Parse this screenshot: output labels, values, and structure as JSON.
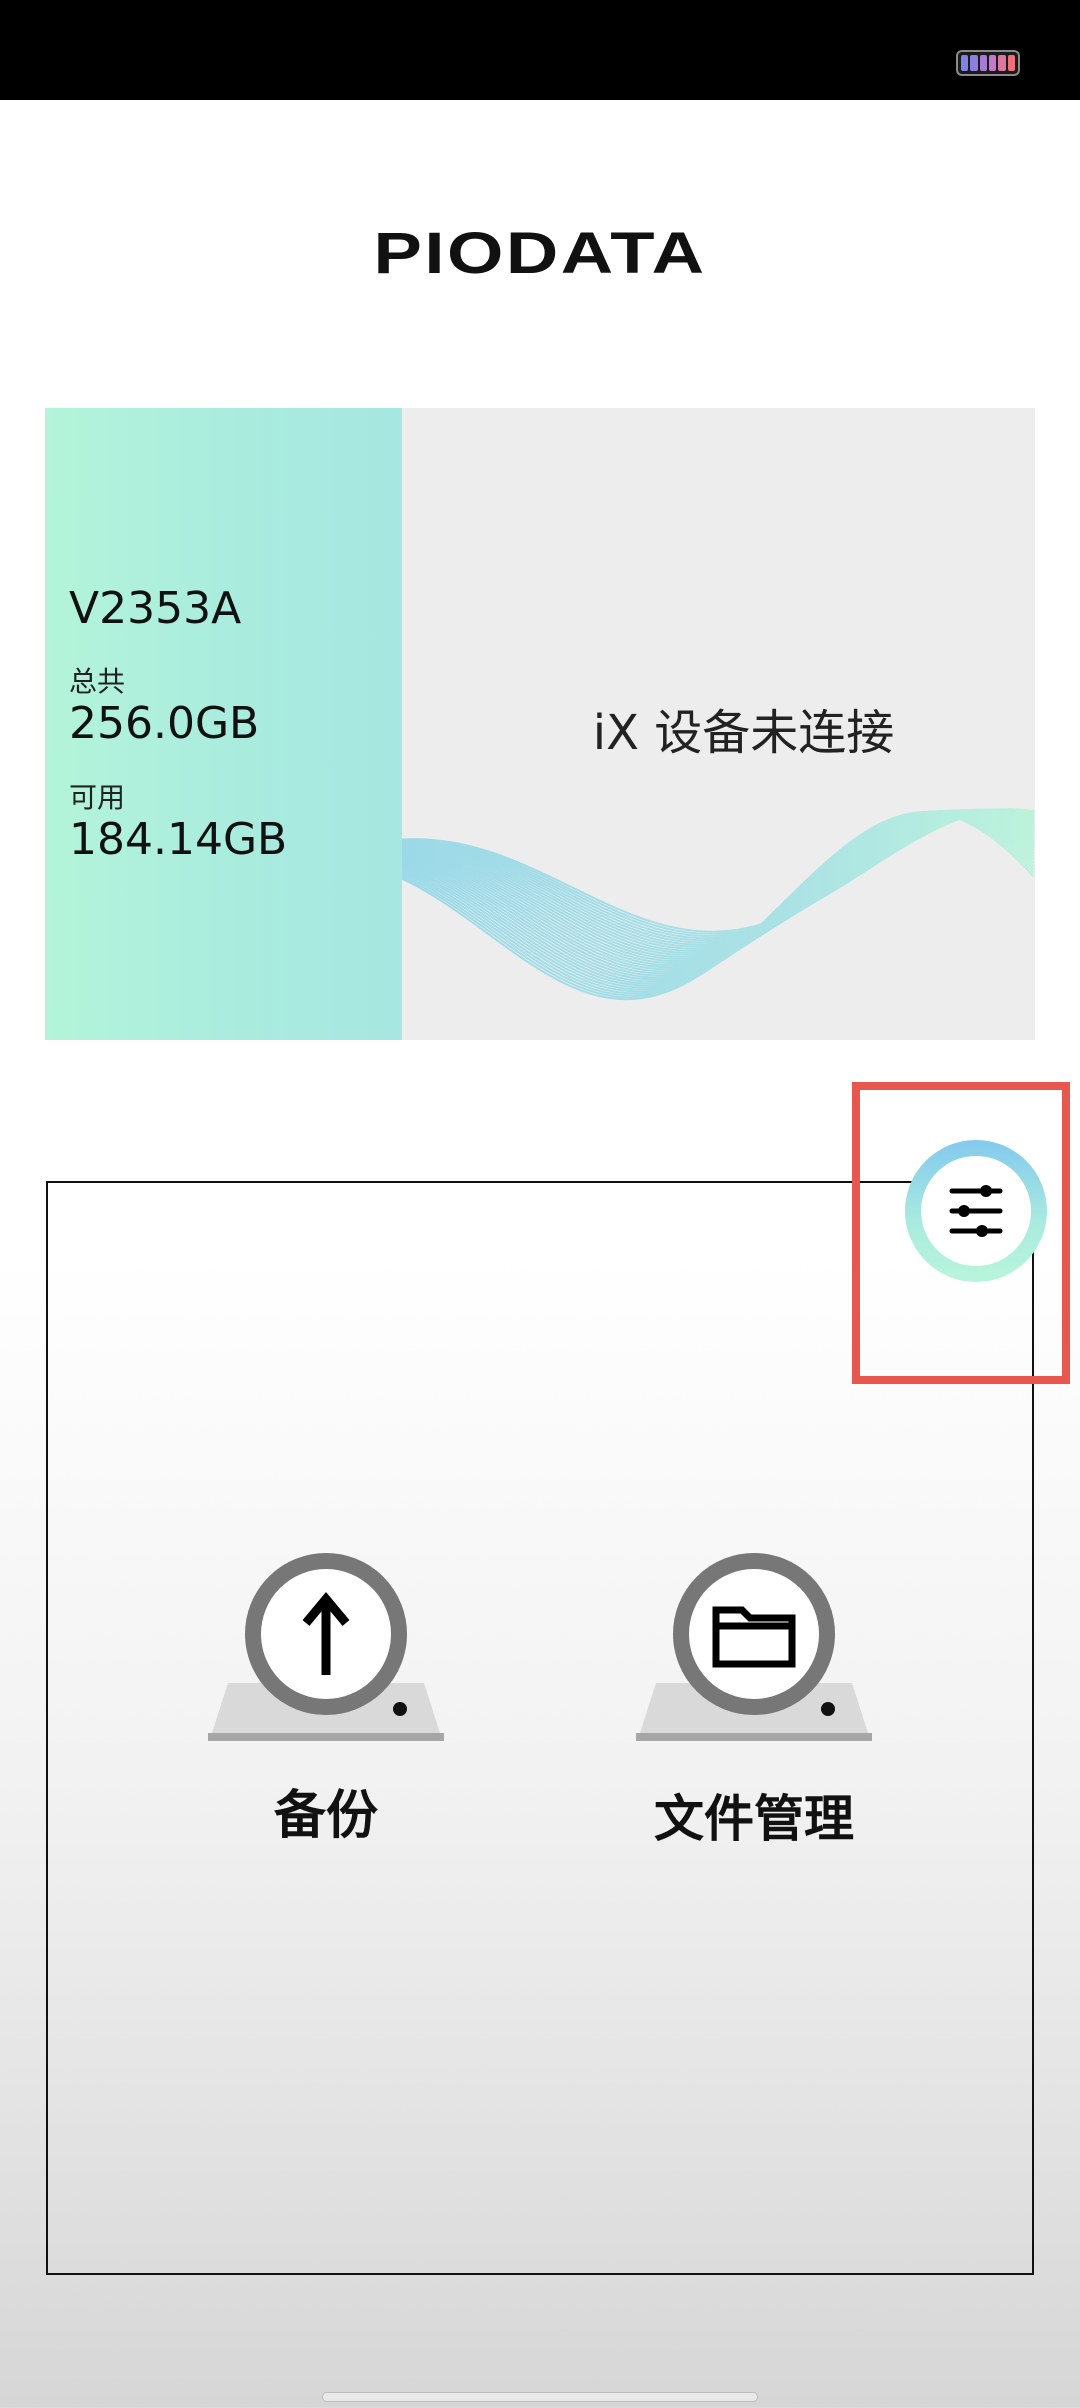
{
  "app": {
    "logo_text": "PIODATA"
  },
  "storage_card": {
    "model": "V2353A",
    "total_label": "总共",
    "total_value": "256.0GB",
    "available_label": "可用",
    "available_value": "184.14GB",
    "device_status": "iX 设备未连接"
  },
  "actions": {
    "backup_label": "备份",
    "file_manager_label": "文件管理"
  },
  "icons": {
    "settings": "sliders-icon",
    "backup": "upload-arrow-icon",
    "file_manager": "folder-icon"
  },
  "colors": {
    "accent_mint": "#b3f4da",
    "accent_blue": "#84c9ef",
    "highlight": "#e8574e",
    "action_ring": "#777777"
  }
}
